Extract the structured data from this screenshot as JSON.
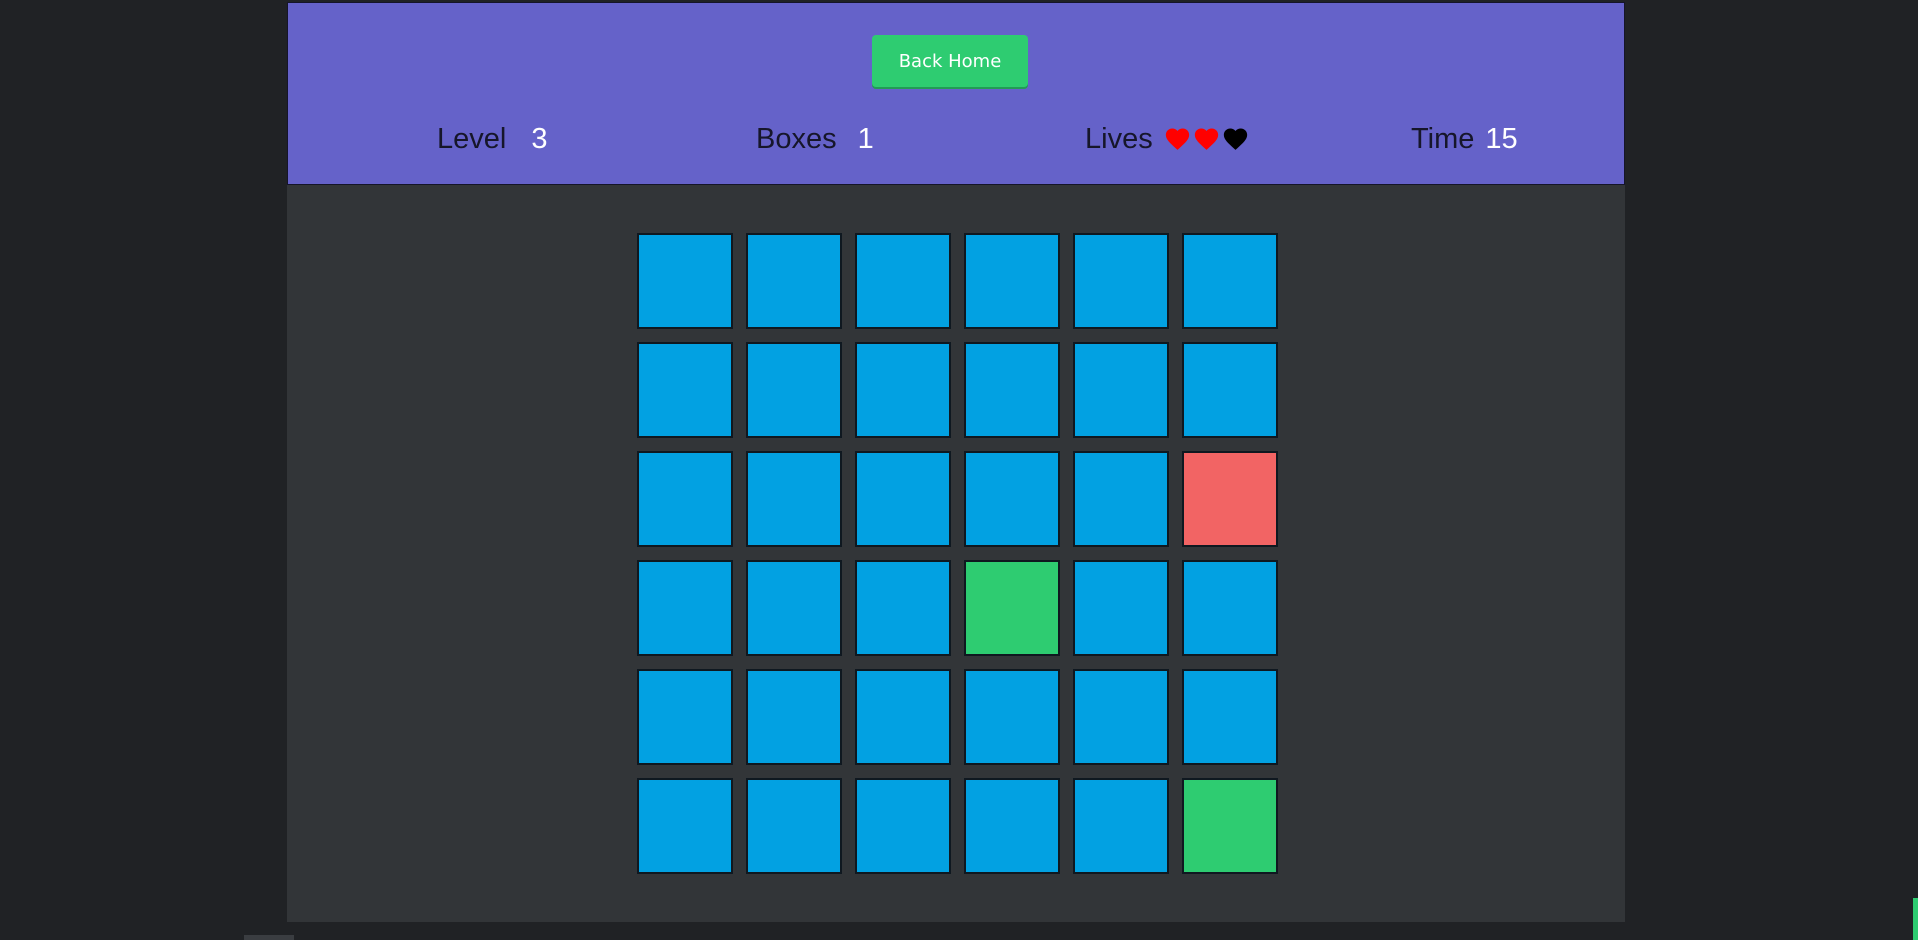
{
  "header": {
    "back_button_label": "Back Home",
    "level": {
      "label": "Level",
      "value": "3"
    },
    "boxes": {
      "label": "Boxes",
      "value": "1"
    },
    "lives": {
      "label": "Lives",
      "total": 3,
      "remaining": 2,
      "hearts": [
        "full",
        "full",
        "empty"
      ]
    },
    "time": {
      "label": "Time",
      "value": "15"
    }
  },
  "colors": {
    "header_bg": "#6562c9",
    "board_bg": "#323538",
    "page_bg": "#202225",
    "tile_default": "#02a1e2",
    "tile_correct": "#2ecc71",
    "tile_wrong": "#f26464",
    "heart_full": "#ff0000",
    "heart_empty": "#000000",
    "button_bg": "#2ecc71"
  },
  "board": {
    "rows": 6,
    "cols": 6,
    "tiles": [
      [
        "default",
        "default",
        "default",
        "default",
        "default",
        "default"
      ],
      [
        "default",
        "default",
        "default",
        "default",
        "default",
        "default"
      ],
      [
        "default",
        "default",
        "default",
        "default",
        "default",
        "wrong"
      ],
      [
        "default",
        "default",
        "default",
        "correct",
        "default",
        "default"
      ],
      [
        "default",
        "default",
        "default",
        "default",
        "default",
        "default"
      ],
      [
        "default",
        "default",
        "default",
        "default",
        "default",
        "correct"
      ]
    ]
  }
}
